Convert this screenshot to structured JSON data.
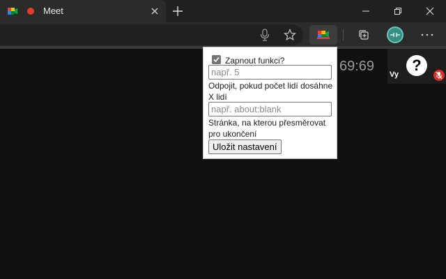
{
  "browser": {
    "tab": {
      "title": "Meet",
      "favicon": "google-meet-icon",
      "recording": true
    },
    "new_tab": "plus-icon",
    "window_controls": [
      "minimize-icon",
      "restore-icon",
      "close-icon"
    ],
    "toolbar_icons": [
      "microphone-icon",
      "star-icon",
      "extension-icon",
      "collections-icon",
      "profile-avatar",
      "more-icon"
    ]
  },
  "meet": {
    "clock": "69:69",
    "self_name": "Vy",
    "help_glyph": "?"
  },
  "popup": {
    "enable_label": "Zapnout funkci?",
    "enable_checked": true,
    "count_placeholder": "např. 5",
    "count_description": "Odpojit, pokud počet lidí dosáhne X lidí",
    "url_placeholder": "např. about:blank",
    "url_description": "Stránka, na kterou přesměrovat pro ukončení",
    "save_label": "Uložit nastavení"
  }
}
